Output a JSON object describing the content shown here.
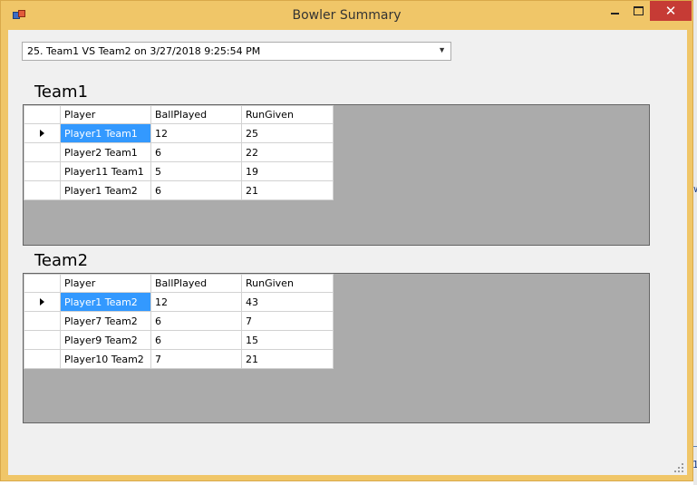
{
  "window": {
    "title": "Bowler Summary"
  },
  "match_selector": {
    "value": "25. Team1 VS Team2 on 3/27/2018 9:25:54 PM"
  },
  "columns": [
    "Player",
    "BallPlayed",
    "RunGiven"
  ],
  "background": {
    "fragment_right": "w",
    "fragment_bottom": "1"
  },
  "teams": [
    {
      "name": "Team1",
      "rows": [
        {
          "player": "Player1 Team1",
          "balls": "12",
          "runs": "25"
        },
        {
          "player": "Player2 Team1",
          "balls": "6",
          "runs": "22"
        },
        {
          "player": "Player11 Team1",
          "balls": "5",
          "runs": "19"
        },
        {
          "player": "Player1 Team2",
          "balls": "6",
          "runs": "21"
        }
      ]
    },
    {
      "name": "Team2",
      "rows": [
        {
          "player": "Player1 Team2",
          "balls": "12",
          "runs": "43"
        },
        {
          "player": "Player7 Team2",
          "balls": "6",
          "runs": "7"
        },
        {
          "player": "Player9 Team2",
          "balls": "6",
          "runs": "15"
        },
        {
          "player": "Player10 Team2",
          "balls": "7",
          "runs": "21"
        }
      ]
    }
  ]
}
